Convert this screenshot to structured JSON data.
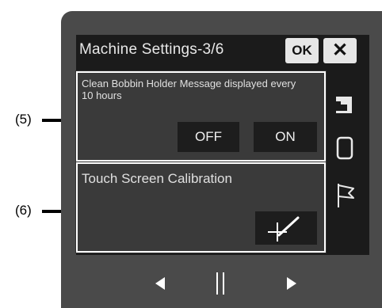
{
  "callouts": {
    "five": "(5)",
    "six": "(6)"
  },
  "header": {
    "title": "Machine Settings-3/6",
    "ok_label": "OK",
    "close_label": "✕"
  },
  "bobbin_setting": {
    "message": "Clean Bobbin Holder Message displayed every 10 hours",
    "off_label": "OFF",
    "on_label": "ON"
  },
  "calibration": {
    "label": "Touch Screen Calibration",
    "icon": "calibration-crosshair-icon"
  },
  "side_tabs": [
    "sewing-machine-icon",
    "embroidery-frame-icon",
    "flag-icon"
  ],
  "nav": {
    "prev_icon": "triangle-left-icon",
    "pause_icon": "double-bar-icon",
    "next_icon": "triangle-right-icon"
  },
  "colors": {
    "device": "#4a4a4a",
    "screen": "#1b1b1b",
    "panel": "#3a3a3a",
    "button": "#1d1d1d"
  }
}
